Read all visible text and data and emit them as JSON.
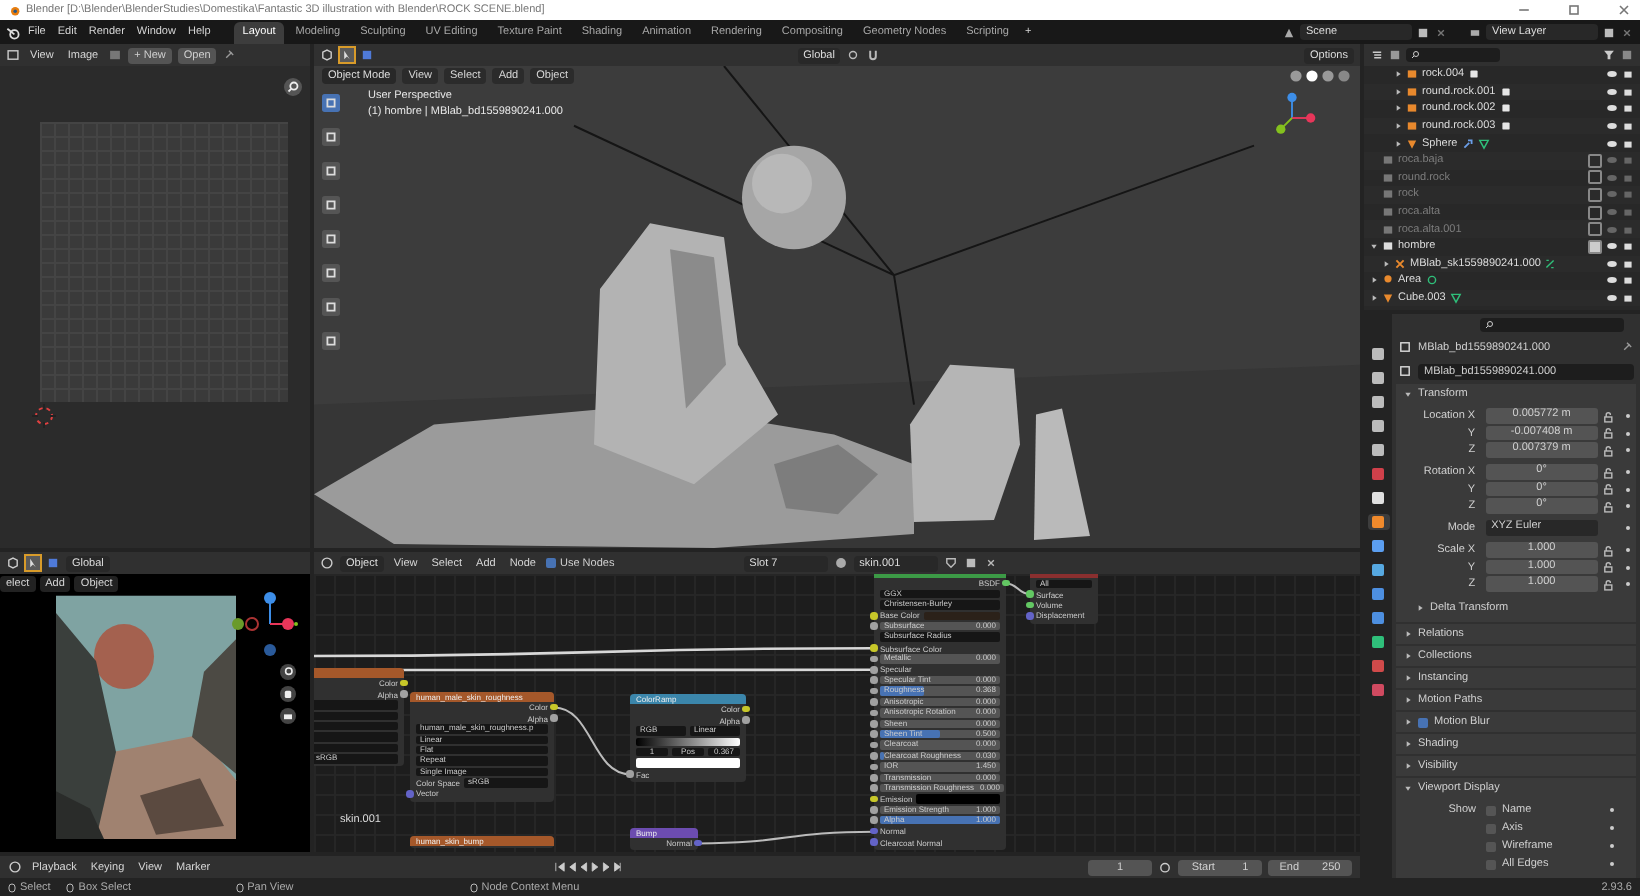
{
  "title_bar": {
    "title": "Blender [D:\\Blender\\BlenderStudies\\Domestika\\Fantastic 3D illustration with Blender\\ROCK SCENE.blend]"
  },
  "menu": [
    "File",
    "Edit",
    "Render",
    "Window",
    "Help"
  ],
  "workspaces": [
    {
      "label": "Layout",
      "selected": true
    },
    {
      "label": "Modeling",
      "selected": false
    },
    {
      "label": "Sculpting",
      "selected": false
    },
    {
      "label": "UV Editing",
      "selected": false
    },
    {
      "label": "Texture Paint",
      "selected": false
    },
    {
      "label": "Shading",
      "selected": false
    },
    {
      "label": "Animation",
      "selected": false
    },
    {
      "label": "Rendering",
      "selected": false
    },
    {
      "label": "Compositing",
      "selected": false
    },
    {
      "label": "Geometry Nodes",
      "selected": false
    },
    {
      "label": "Scripting",
      "selected": false
    }
  ],
  "add_workspace": "+",
  "scene": "Scene",
  "view_layer": "View Layer",
  "image_editor": {
    "menus": [
      "View",
      "Image"
    ],
    "new": "+ New",
    "open": "Open"
  },
  "viewport": {
    "transform": "Global",
    "mode": "Object Mode",
    "menus": [
      "View",
      "Select",
      "Add",
      "Object"
    ],
    "options": "Options",
    "view_name": "User Perspective",
    "object_info": "(1) hombre | MBlab_bd1559890241.000"
  },
  "camera_view": {
    "transform": "Global",
    "menus": [
      "elect",
      "Add",
      "Object"
    ]
  },
  "node_editor": {
    "object": "Object",
    "menus": [
      "View",
      "Select",
      "Add",
      "Node"
    ],
    "use_nodes": {
      "label": "Use Nodes",
      "checked": true
    },
    "slot": "Slot 7",
    "material": "skin.001",
    "material_label": "skin.001",
    "nodes": [
      {
        "kind": "texture",
        "rows": [
          {
            "kind": "out",
            "label": "Color",
            "color": "#c7c729"
          },
          {
            "kind": "out",
            "label": "Alpha",
            "color": "#a1a1a1"
          },
          {
            "kind": "blank"
          },
          {
            "kind": "blank"
          },
          {
            "kind": "blank"
          },
          {
            "kind": "blank"
          },
          {
            "kind": "blank"
          },
          {
            "kind": "dropdown",
            "value": "sRGB"
          }
        ]
      },
      {
        "kind": "texture",
        "title": "human_male_skin_roughness",
        "rows": [
          {
            "kind": "out",
            "label": "Color",
            "color": "#c7c729"
          },
          {
            "kind": "out",
            "label": "Alpha",
            "color": "#a1a1a1"
          },
          {
            "kind": "field",
            "value": "human_male_skin_roughness.p"
          },
          {
            "kind": "dropdown",
            "value": "Linear"
          },
          {
            "kind": "dropdown",
            "value": "Flat"
          },
          {
            "kind": "dropdown",
            "value": "Repeat"
          },
          {
            "kind": "dropdown",
            "value": "Single Image"
          },
          {
            "kind": "prop",
            "label": "Color Space",
            "value": "sRGB"
          },
          {
            "kind": "in",
            "label": "Vector",
            "color": "#6363c7"
          }
        ]
      },
      {
        "kind": "converter",
        "title": "ColorRamp",
        "rows": [
          {
            "kind": "out",
            "label": "Color",
            "color": "#c7c729"
          },
          {
            "kind": "out",
            "label": "Alpha",
            "color": "#a1a1a1"
          },
          {
            "kind": "pair",
            "value": "RGB",
            "value2": "Linear"
          },
          {
            "kind": "gradient"
          },
          {
            "kind": "triple",
            "values": [
              "1",
              "Pos",
              "0.367"
            ]
          },
          {
            "kind": "swatch",
            "color": "#ffffff"
          },
          {
            "kind": "in",
            "label": "Fac",
            "color": "#a1a1a1"
          }
        ]
      },
      {
        "kind": "texture",
        "title": "human_skin_bump"
      },
      {
        "kind": "vector",
        "title": "Bump",
        "rows": [
          {
            "kind": "out",
            "label": "Normal",
            "color": "#6363c7"
          }
        ]
      },
      {
        "kind": "shader",
        "rows": [
          {
            "kind": "out",
            "label": "BSDF",
            "color": "#63c763"
          },
          {
            "kind": "dropdown",
            "value": "GGX"
          },
          {
            "kind": "dropdown",
            "value": "Christensen-Burley"
          },
          {
            "kind": "color_in",
            "label": "Base Color",
            "color": "#2b2119"
          },
          {
            "kind": "number",
            "label": "Subsurface",
            "value": "0.000"
          },
          {
            "kind": "dropdown",
            "value": "Subsurface Radius"
          },
          {
            "kind": "in",
            "label": "Subsurface Color",
            "color": "#c7c729"
          },
          {
            "kind": "number",
            "label": "Metallic",
            "value": "0.000"
          },
          {
            "kind": "in",
            "label": "Specular",
            "color": "#a1a1a1"
          },
          {
            "kind": "number",
            "label": "Specular Tint",
            "value": "0.000"
          },
          {
            "kind": "value",
            "label": "Roughness",
            "value": "0.368",
            "level": 0.37
          },
          {
            "kind": "number",
            "label": "Anisotropic",
            "value": "0.000"
          },
          {
            "kind": "number",
            "label": "Anisotropic Rotation",
            "value": "0.000"
          },
          {
            "kind": "number",
            "label": "Sheen",
            "value": "0.000"
          },
          {
            "kind": "value",
            "label": "Sheen Tint",
            "value": "0.500",
            "level": 0.5
          },
          {
            "kind": "number",
            "label": "Clearcoat",
            "value": "0.000"
          },
          {
            "kind": "value",
            "label": "Clearcoat Roughness",
            "value": "0.030",
            "level": 0.03
          },
          {
            "kind": "number",
            "label": "IOR",
            "value": "1.450"
          },
          {
            "kind": "number",
            "label": "Transmission",
            "value": "0.000"
          },
          {
            "kind": "number",
            "label": "Transmission Roughness",
            "value": "0.000"
          },
          {
            "kind": "color_in",
            "label": "Emission",
            "color": "#000000"
          },
          {
            "kind": "number",
            "label": "Emission Strength",
            "value": "1.000"
          },
          {
            "kind": "value",
            "label": "Alpha",
            "value": "1.000",
            "level": 1
          },
          {
            "kind": "in",
            "label": "Normal",
            "color": "#6363c7"
          },
          {
            "kind": "in",
            "label": "Clearcoat Normal",
            "color": "#6363c7"
          }
        ]
      },
      {
        "kind": "output",
        "rows": [
          {
            "kind": "dropdown",
            "value": "All"
          },
          {
            "kind": "in",
            "label": "Surface",
            "color": "#63c763"
          },
          {
            "kind": "in",
            "label": "Volume",
            "color": "#63c763"
          },
          {
            "kind": "in",
            "label": "Displacement",
            "color": "#6363c7"
          }
        ]
      }
    ]
  },
  "timeline": {
    "menus": [
      "Playback",
      "Keying",
      "View",
      "Marker"
    ],
    "current_frame": "1",
    "start_label": "Start",
    "start": "1",
    "end_label": "End",
    "end": "250"
  },
  "outliner": {
    "continued_children": [
      {
        "name": "rock.004",
        "kind": "instance",
        "data_icons": [
          {
            "kind": "collection"
          }
        ]
      },
      {
        "name": "round.rock.001",
        "kind": "instance",
        "data_icons": [
          {
            "kind": "collection"
          }
        ]
      },
      {
        "name": "round.rock.002",
        "kind": "instance",
        "data_icons": [
          {
            "kind": "collection"
          }
        ]
      },
      {
        "name": "round.rock.003",
        "kind": "instance",
        "data_icons": [
          {
            "kind": "collection"
          }
        ]
      },
      {
        "name": "Sphere",
        "kind": "mesh",
        "data_icons": [
          {
            "kind": "modifier"
          },
          {
            "kind": "mesh_data"
          }
        ]
      }
    ],
    "items": [
      {
        "name": "roca.baja",
        "kind": "collection",
        "included": false
      },
      {
        "name": "round.rock",
        "kind": "collection",
        "included": false
      },
      {
        "name": "rock",
        "kind": "collection",
        "included": false
      },
      {
        "name": "roca.alta",
        "kind": "collection",
        "included": false
      },
      {
        "name": "roca.alta.001",
        "kind": "collection",
        "included": false
      },
      {
        "name": "hombre",
        "kind": "collection",
        "included": true,
        "children": [
          {
            "name": "MBlab_sk1559890241.000",
            "kind": "armature",
            "data_icons": [
              {
                "kind": "bone_data"
              }
            ]
          }
        ]
      },
      {
        "name": "Area",
        "kind": "light",
        "data_icons": [
          {
            "kind": "light_data"
          }
        ]
      },
      {
        "name": "Cube.003",
        "kind": "mesh",
        "data_icons": [
          {
            "kind": "mesh_data"
          }
        ]
      }
    ]
  },
  "properties": {
    "tabs": [
      {
        "kind": "tool",
        "selected": false
      },
      {
        "kind": "render",
        "selected": false
      },
      {
        "kind": "output",
        "selected": false
      },
      {
        "kind": "view_layer",
        "selected": false
      },
      {
        "kind": "scene",
        "selected": false
      },
      {
        "kind": "world",
        "selected": false
      },
      {
        "kind": "collection",
        "selected": false
      },
      {
        "kind": "object",
        "selected": true
      },
      {
        "kind": "modifier",
        "selected": false
      },
      {
        "kind": "particles",
        "selected": false
      },
      {
        "kind": "physics",
        "selected": false
      },
      {
        "kind": "constraints",
        "selected": false
      },
      {
        "kind": "data",
        "selected": false
      },
      {
        "kind": "material",
        "selected": false
      },
      {
        "kind": "texture",
        "selected": false
      }
    ],
    "object_name": "MBlab_bd1559890241.000",
    "data_name": "MBlab_bd1559890241.000",
    "transform": {
      "title": "Transform",
      "expanded": true,
      "groups": [
        [
          {
            "kind": "field",
            "label": "Location X",
            "value": "0.005772 m"
          },
          {
            "kind": "field",
            "label": "Y",
            "value": "-0.007408 m"
          },
          {
            "kind": "field",
            "label": "Z",
            "value": "0.007379 m"
          }
        ],
        [
          {
            "kind": "field",
            "label": "Rotation X",
            "value": "0°"
          },
          {
            "kind": "field",
            "label": "Y",
            "value": "0°"
          },
          {
            "kind": "field",
            "label": "Z",
            "value": "0°"
          }
        ],
        [
          {
            "kind": "dropdown",
            "label": "Mode",
            "value": "XYZ Euler"
          }
        ],
        [
          {
            "kind": "field",
            "label": "Scale X",
            "value": "1.000"
          },
          {
            "kind": "field",
            "label": "Y",
            "value": "1.000"
          },
          {
            "kind": "field",
            "label": "Z",
            "value": "1.000"
          }
        ]
      ]
    },
    "delta": {
      "title": "Delta Transform",
      "expanded": false
    },
    "panels": [
      {
        "title": "Relations",
        "kind": "plain",
        "expanded": false
      },
      {
        "title": "Collections",
        "kind": "plain",
        "expanded": false
      },
      {
        "title": "Instancing",
        "kind": "plain",
        "expanded": false
      },
      {
        "title": "Motion Paths",
        "kind": "plain",
        "expanded": false
      },
      {
        "title": "Motion Blur",
        "kind": "checkbox",
        "checked": true,
        "expanded": false
      },
      {
        "title": "Shading",
        "kind": "plain",
        "expanded": false
      },
      {
        "title": "Visibility",
        "kind": "plain",
        "expanded": false
      },
      {
        "title": "Viewport Display",
        "kind": "plain",
        "expanded": true
      }
    ],
    "viewport_display": {
      "show_label": "Show",
      "options": [
        {
          "label": "Name",
          "checked": false
        },
        {
          "label": "Axis",
          "checked": false
        },
        {
          "label": "Wireframe",
          "checked": false
        },
        {
          "label": "All Edges",
          "checked": false
        }
      ]
    }
  },
  "status_bar": {
    "hints": [
      "Select",
      "Box Select",
      "Pan View",
      "Node Context Menu"
    ],
    "version": "2.93.6"
  }
}
